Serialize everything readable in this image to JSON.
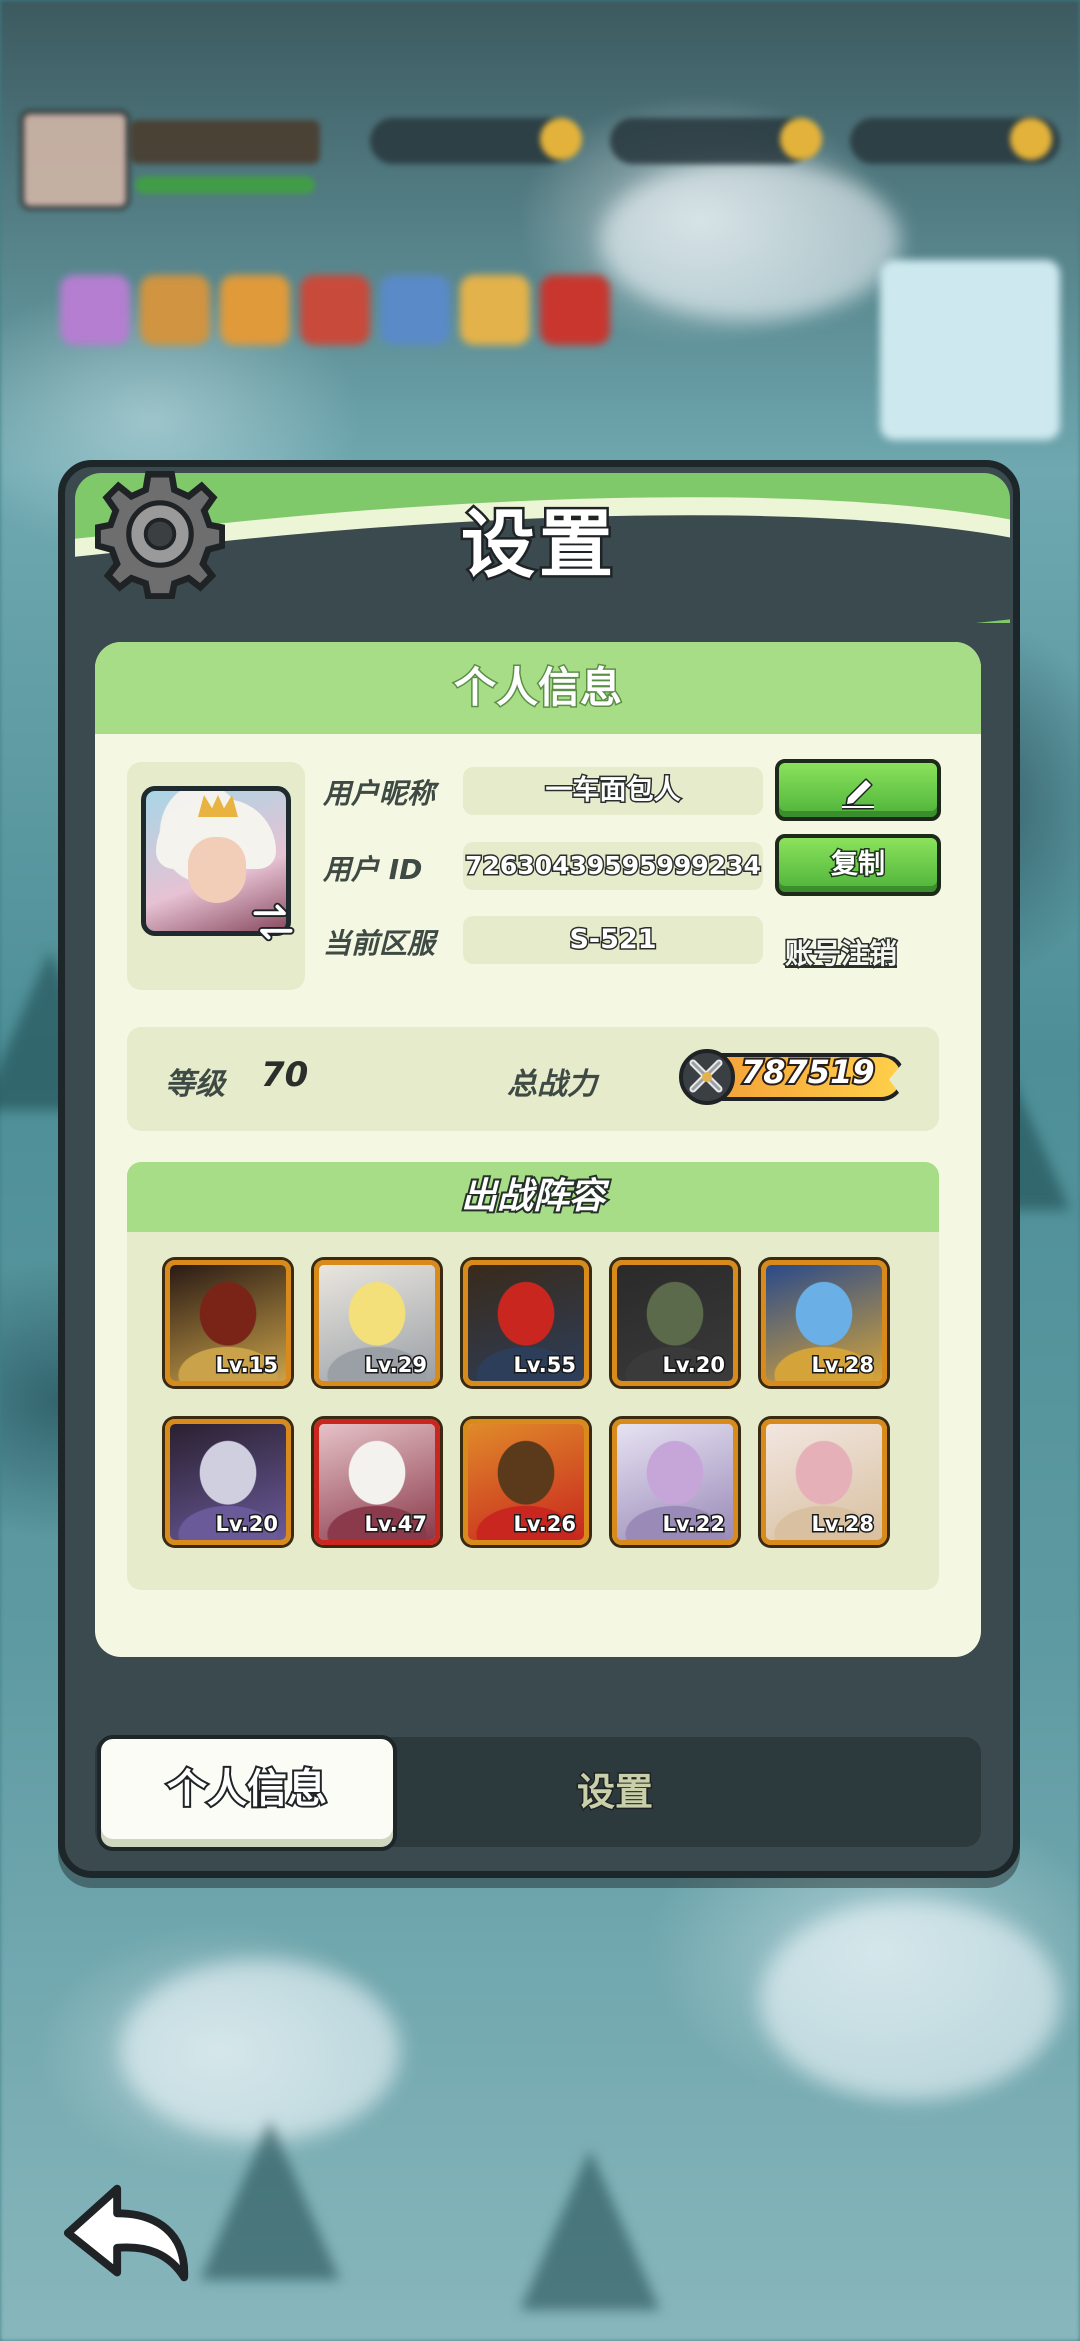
{
  "modal": {
    "title": "设置"
  },
  "profile": {
    "section_title": "个人信息",
    "nickname_label": "用户昵称",
    "nickname": "一车面包人",
    "user_id_label": "用户 ID",
    "user_id": "7263043959599923​4",
    "server_label": "当前区服",
    "server": "S-521",
    "copy_button": "复制",
    "delete_account_link": "账号注销"
  },
  "stats": {
    "level_label": "等级",
    "level": "70",
    "power_label": "总战力",
    "power": "787519"
  },
  "lineup": {
    "title": "出战阵容",
    "heroes": [
      {
        "level": "Lv.15",
        "frame": "gold"
      },
      {
        "level": "Lv.29",
        "frame": "gold"
      },
      {
        "level": "Lv.55",
        "frame": "gold"
      },
      {
        "level": "Lv.20",
        "frame": "gold"
      },
      {
        "level": "Lv.28",
        "frame": "gold"
      },
      {
        "level": "Lv.20",
        "frame": "gold"
      },
      {
        "level": "Lv.47",
        "frame": "red"
      },
      {
        "level": "Lv.26",
        "frame": "gold"
      },
      {
        "level": "Lv.22",
        "frame": "gold"
      },
      {
        "level": "Lv.28",
        "frame": "gold"
      }
    ]
  },
  "tabs": {
    "active": "个人信息",
    "inactive": "设置"
  },
  "colors": {
    "accent_green": "#7fc96a",
    "panel_bg": "#f4f8e2",
    "frame_gold": "#d88a1a",
    "frame_red": "#c8261e"
  }
}
